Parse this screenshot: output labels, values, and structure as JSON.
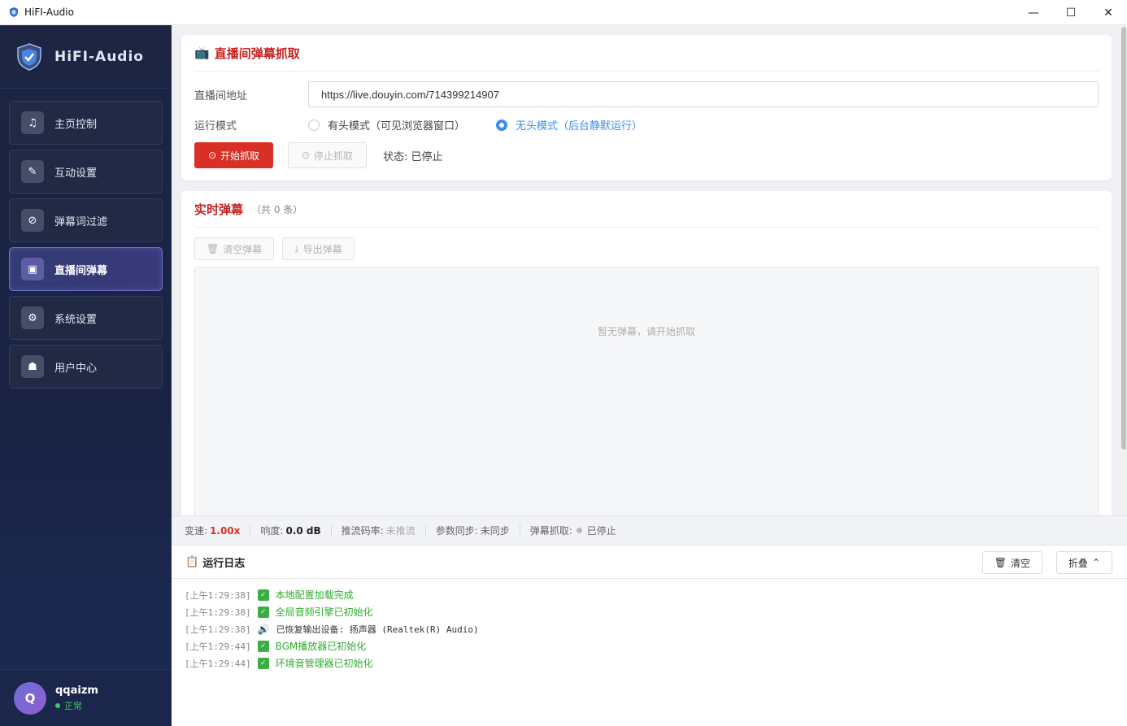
{
  "window": {
    "title": "HiFI-Audio",
    "controls": [
      "—",
      "☐",
      "✕"
    ]
  },
  "sidebar": {
    "brand": "HiFI-Audio",
    "items": [
      {
        "label": "主页控制",
        "icon": "music-note-icon",
        "glyph": "♫"
      },
      {
        "label": "互动设置",
        "icon": "magic-wand-icon",
        "glyph": "✎"
      },
      {
        "label": "弹幕词过滤",
        "icon": "block-icon",
        "glyph": "⊘"
      },
      {
        "label": "直播间弹幕",
        "icon": "tv-icon",
        "glyph": "▣"
      },
      {
        "label": "系统设置",
        "icon": "gear-icon",
        "glyph": "⚙"
      },
      {
        "label": "用户中心",
        "icon": "user-icon",
        "glyph": "☗"
      }
    ],
    "active_index": 3,
    "user": {
      "avatar_letter": "Q",
      "name": "qqaizm",
      "status": "正常"
    }
  },
  "capture": {
    "title": "直播间弹幕抓取",
    "url_label": "直播间地址",
    "url_value": "https://live.douyin.com/714399214907",
    "mode_label": "运行模式",
    "mode_options": [
      "有头模式（可见浏览器窗口）",
      "无头模式（后台静默运行）"
    ],
    "mode_selected": 1,
    "start_button": "开始抓取",
    "stop_button": "停止抓取",
    "status": "状态: 已停止"
  },
  "realtime": {
    "title": "实时弹幕",
    "count": "（共 0 条）",
    "clear_button": "清空弹幕",
    "export_button": "导出弹幕",
    "empty_text": "暂无弹幕，请开始抓取"
  },
  "status_bar": {
    "speed_label": "变速:",
    "speed_value": "1.00x",
    "loudness_label": "响度:",
    "loudness_value": "0.0 dB",
    "bitrate_label": "推流码率:",
    "bitrate_value": "未推流",
    "sync_label": "参数同步:",
    "sync_value": "未同步",
    "capture_label": "弹幕抓取:",
    "capture_value": "已停止"
  },
  "log": {
    "title": "运行日志",
    "clear_button": "清空",
    "fold_button": "折叠",
    "lines": [
      {
        "time": "[上午1:29:38]",
        "kind": "ok",
        "text": "本地配置加载完成"
      },
      {
        "time": "[上午1:29:38]",
        "kind": "ok",
        "text": "全局音频引擎已初始化"
      },
      {
        "time": "[上午1:29:38]",
        "kind": "speaker",
        "text": "已恢复输出设备: 扬声器 (Realtek(R) Audio)"
      },
      {
        "time": "[上午1:29:44]",
        "kind": "ok",
        "text": "BGM播放器已初始化"
      },
      {
        "time": "[上午1:29:44]",
        "kind": "ok",
        "text": "环境音管理器已初始化"
      }
    ]
  },
  "colors": {
    "accent_red": "#d93025",
    "accent_blue": "#3b8fe8",
    "ok_green": "#3aae41",
    "sidebar_bg": "#1d2543"
  }
}
